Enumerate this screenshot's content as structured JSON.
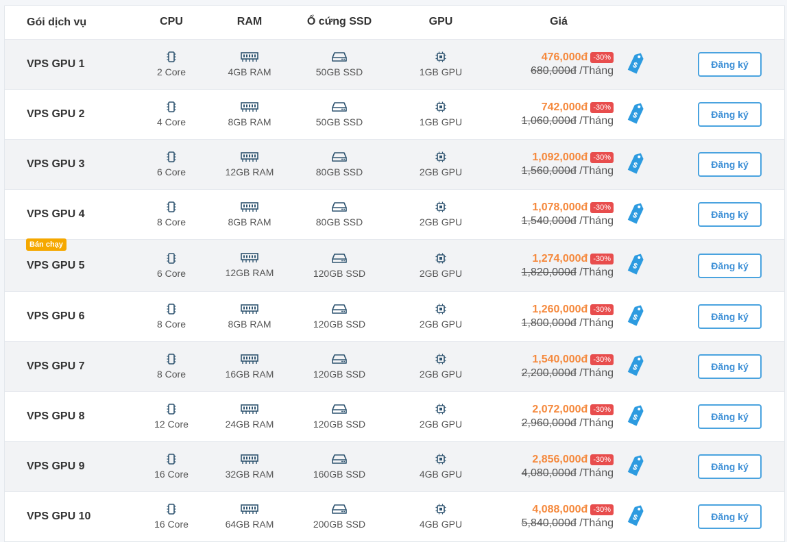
{
  "header": {
    "name": "Gói dịch vụ",
    "cpu": "CPU",
    "ram": "RAM",
    "ssd": "Ổ cứng SSD",
    "gpu": "GPU",
    "price": "Giá"
  },
  "colors": {
    "accent": "#f5893d",
    "discount": "#e84d4d",
    "button": "#4aa3df",
    "badge": "#f5a800"
  },
  "icons": {
    "cpu": "cpu-chip-icon",
    "ram": "ram-stick-icon",
    "ssd": "hard-drive-icon",
    "gpu": "processor-icon",
    "tag": "price-tag-icon"
  },
  "plans": [
    {
      "name": "VPS GPU 1",
      "cpu": "2 Core",
      "ram": "4GB RAM",
      "ssd": "50GB SSD",
      "gpu": "1GB GPU",
      "price": "476,000đ",
      "discount": "-30%",
      "old": "680,000đ",
      "per": "/Tháng",
      "btn": "Đăng ký",
      "badge": ""
    },
    {
      "name": "VPS GPU 2",
      "cpu": "4 Core",
      "ram": "8GB RAM",
      "ssd": "50GB SSD",
      "gpu": "1GB GPU",
      "price": "742,000đ",
      "discount": "-30%",
      "old": "1,060,000đ",
      "per": "/Tháng",
      "btn": "Đăng ký",
      "badge": ""
    },
    {
      "name": "VPS GPU 3",
      "cpu": "6 Core",
      "ram": "12GB RAM",
      "ssd": "80GB SSD",
      "gpu": "2GB GPU",
      "price": "1,092,000đ",
      "discount": "-30%",
      "old": "1,560,000đ",
      "per": "/Tháng",
      "btn": "Đăng ký",
      "badge": ""
    },
    {
      "name": "VPS GPU 4",
      "cpu": "8 Core",
      "ram": "8GB RAM",
      "ssd": "80GB SSD",
      "gpu": "2GB GPU",
      "price": "1,078,000đ",
      "discount": "-30%",
      "old": "1,540,000đ",
      "per": "/Tháng",
      "btn": "Đăng ký",
      "badge": ""
    },
    {
      "name": "VPS GPU 5",
      "cpu": "6 Core",
      "ram": "12GB RAM",
      "ssd": "120GB SSD",
      "gpu": "2GB GPU",
      "price": "1,274,000đ",
      "discount": "-30%",
      "old": "1,820,000đ",
      "per": "/Tháng",
      "btn": "Đăng ký",
      "badge": "Bán chạy"
    },
    {
      "name": "VPS GPU 6",
      "cpu": "8 Core",
      "ram": "8GB RAM",
      "ssd": "120GB SSD",
      "gpu": "2GB GPU",
      "price": "1,260,000đ",
      "discount": "-30%",
      "old": "1,800,000đ",
      "per": "/Tháng",
      "btn": "Đăng ký",
      "badge": ""
    },
    {
      "name": "VPS GPU 7",
      "cpu": "8 Core",
      "ram": "16GB RAM",
      "ssd": "120GB SSD",
      "gpu": "2GB GPU",
      "price": "1,540,000đ",
      "discount": "-30%",
      "old": "2,200,000đ",
      "per": "/Tháng",
      "btn": "Đăng ký",
      "badge": ""
    },
    {
      "name": "VPS GPU 8",
      "cpu": "12 Core",
      "ram": "24GB RAM",
      "ssd": "120GB SSD",
      "gpu": "2GB GPU",
      "price": "2,072,000đ",
      "discount": "-30%",
      "old": "2,960,000đ",
      "per": "/Tháng",
      "btn": "Đăng ký",
      "badge": ""
    },
    {
      "name": "VPS GPU 9",
      "cpu": "16 Core",
      "ram": "32GB RAM",
      "ssd": "160GB SSD",
      "gpu": "4GB GPU",
      "price": "2,856,000đ",
      "discount": "-30%",
      "old": "4,080,000đ",
      "per": "/Tháng",
      "btn": "Đăng ký",
      "badge": ""
    },
    {
      "name": "VPS GPU 10",
      "cpu": "16 Core",
      "ram": "64GB RAM",
      "ssd": "200GB SSD",
      "gpu": "4GB GPU",
      "price": "4,088,000đ",
      "discount": "-30%",
      "old": "5,840,000đ",
      "per": "/Tháng",
      "btn": "Đăng ký",
      "badge": ""
    }
  ]
}
